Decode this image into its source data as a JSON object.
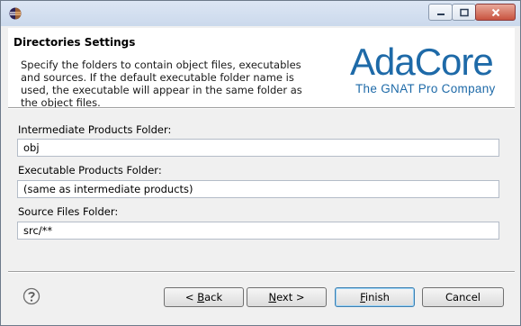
{
  "titlebar": {
    "icon": "eclipse-icon",
    "controls": [
      "minimize-icon",
      "maximize-icon",
      "close-icon"
    ]
  },
  "header": {
    "title": "Directories Settings",
    "description": "Specify the folders to contain object files, executables and sources. If the default executable folder name is used, the executable will appear in the same folder as the object files.",
    "logo_word": "AdaCore",
    "logo_tagline": "The GNAT Pro Company",
    "logo_color": "#1e6aa8"
  },
  "form": {
    "intermediate_label": "Intermediate Products Folder:",
    "intermediate_value": "obj",
    "executable_label": "Executable Products Folder:",
    "executable_value": "(same as intermediate products)",
    "source_label": "Source Files Folder:",
    "source_value": "src/**"
  },
  "buttons": {
    "back_prefix": "< ",
    "back_mnemonic": "B",
    "back_rest": "ack",
    "next_mnemonic": "N",
    "next_rest": "ext >",
    "finish_mnemonic": "F",
    "finish_rest": "inish",
    "cancel": "Cancel"
  }
}
